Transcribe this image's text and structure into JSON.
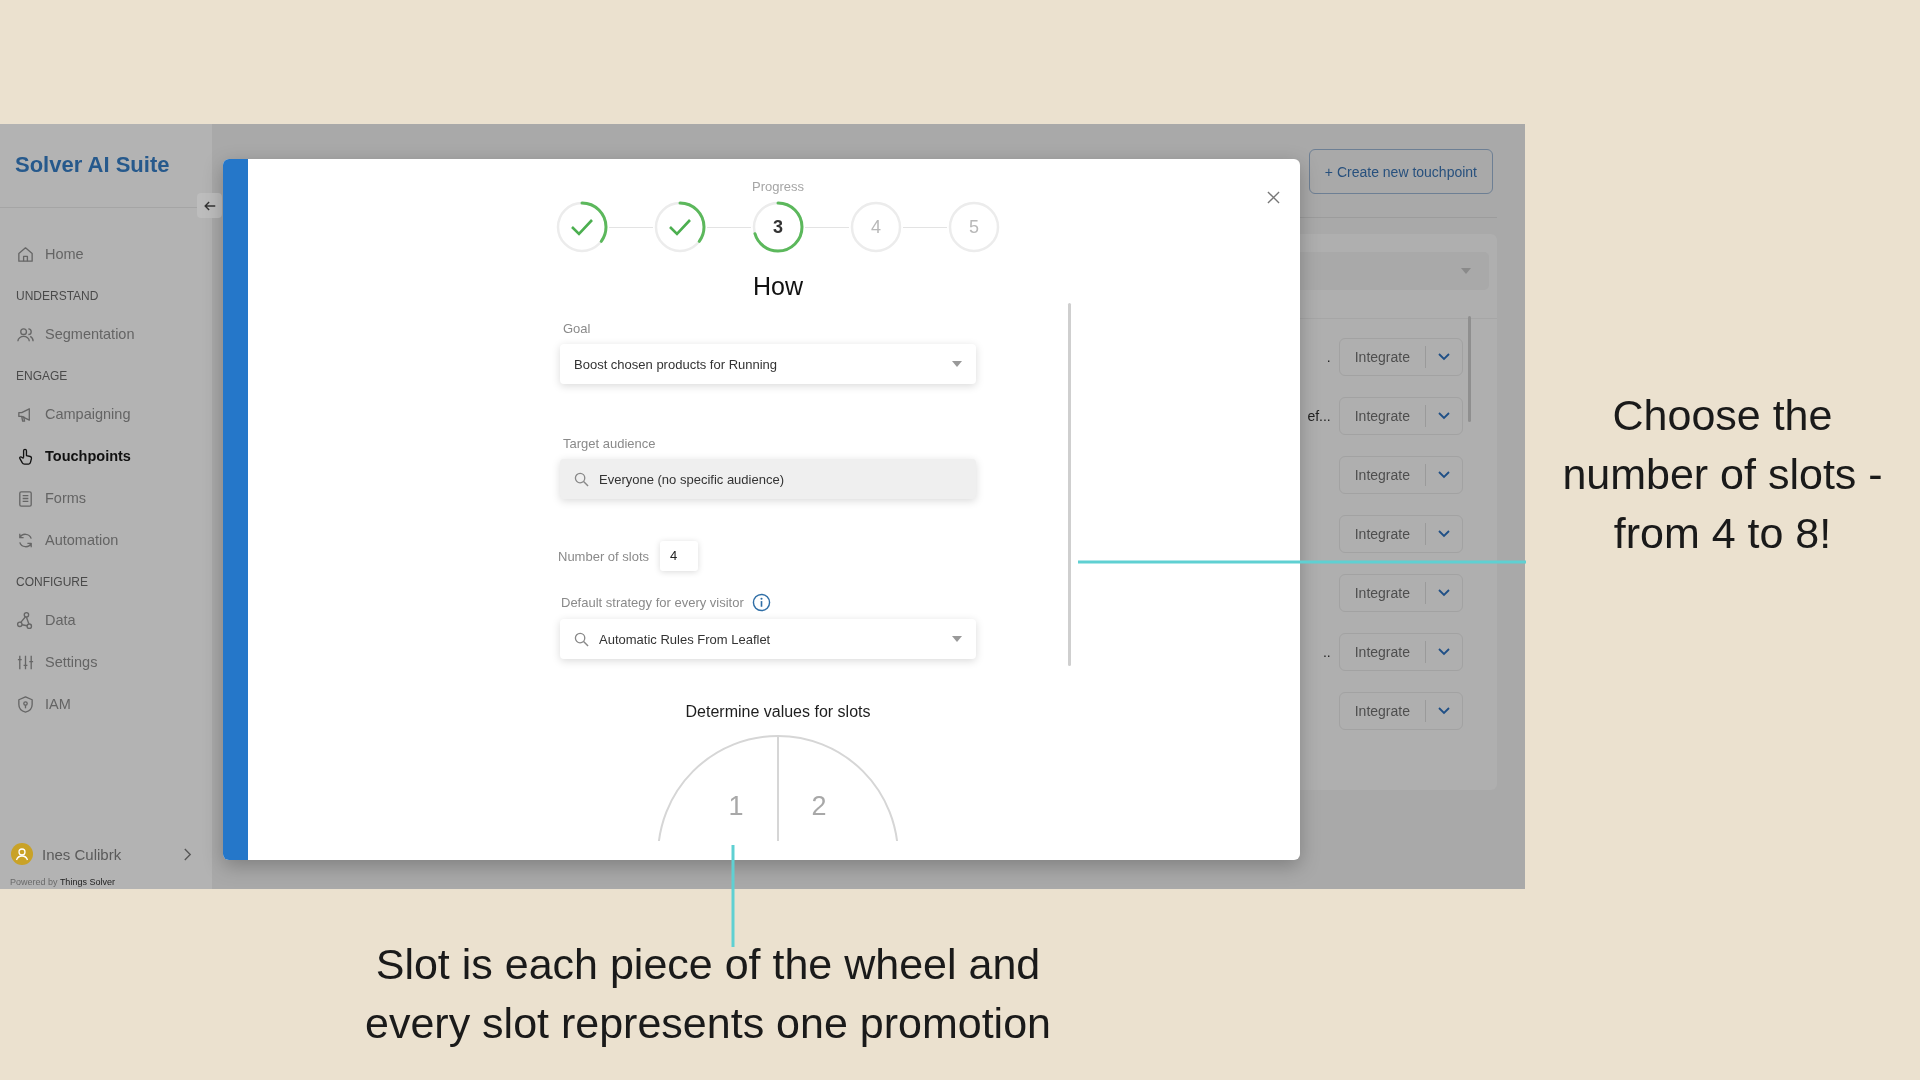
{
  "sidebar": {
    "logo": "Solver AI Suite",
    "sections": [
      {
        "items": [
          {
            "label": "Home",
            "selected": false
          }
        ]
      },
      {
        "heading": "UNDERSTAND",
        "items": [
          {
            "label": "Segmentation",
            "selected": false
          }
        ]
      },
      {
        "heading": "ENGAGE",
        "items": [
          {
            "label": "Campaigning",
            "selected": false
          },
          {
            "label": "Touchpoints",
            "selected": true
          },
          {
            "label": "Forms",
            "selected": false
          },
          {
            "label": "Automation",
            "selected": false
          }
        ]
      },
      {
        "heading": "CONFIGURE",
        "items": [
          {
            "label": "Data",
            "selected": false
          },
          {
            "label": "Settings",
            "selected": false
          },
          {
            "label": "IAM",
            "selected": false
          }
        ]
      }
    ],
    "user": "Ines Culibrk",
    "powered_by": "Powered by",
    "company": "Things Solver"
  },
  "main": {
    "create_button": "+ Create new touchpoint",
    "rows": [
      {
        "fragment": ".",
        "button": "Integrate"
      },
      {
        "fragment": "ef...",
        "button": "Integrate"
      },
      {
        "button": "Integrate"
      },
      {
        "button": "Integrate"
      },
      {
        "button": "Integrate"
      },
      {
        "fragment": "..",
        "button": "Integrate"
      },
      {
        "button": "Integrate"
      }
    ]
  },
  "modal": {
    "progress_label": "Progress",
    "steps": [
      {
        "done": true,
        "current": false
      },
      {
        "done": true,
        "current": false
      },
      {
        "label": "3",
        "done": false,
        "current": true
      },
      {
        "label": "4",
        "done": false,
        "current": false
      },
      {
        "label": "5",
        "done": false,
        "current": false
      }
    ],
    "title": "How",
    "goal": {
      "label": "Goal",
      "value": "Boost chosen products for Running"
    },
    "audience": {
      "label": "Target audience",
      "value": "Everyone (no specific audience)"
    },
    "slots": {
      "label": "Number of slots",
      "value": "4"
    },
    "strategy": {
      "label": "Default strategy for every visitor",
      "value": "Automatic Rules From Leaflet"
    },
    "wheel_title": "Determine values for slots",
    "wheel_slices": [
      {
        "label": "1"
      },
      {
        "label": "2"
      }
    ]
  },
  "side_note": {
    "lines": [
      "Choose the",
      "number of slots -",
      "from 4 to 8!"
    ]
  },
  "caption": {
    "lines": [
      "Slot is each piece of the wheel and",
      "every slot represents one promotion"
    ]
  }
}
